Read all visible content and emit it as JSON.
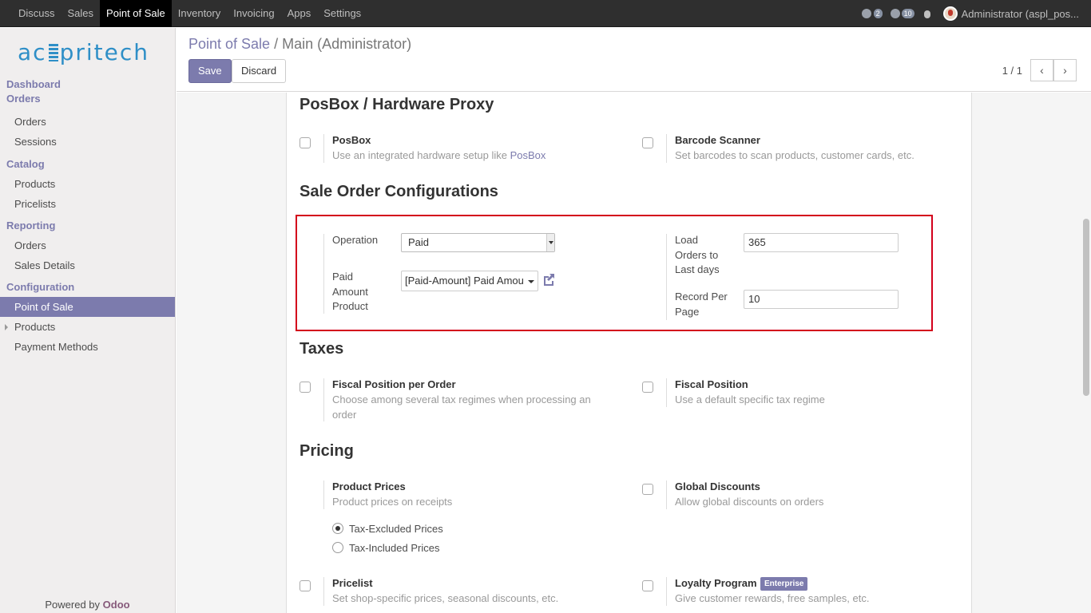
{
  "topbar": {
    "menu": [
      "Discuss",
      "Sales",
      "Point of Sale",
      "Inventory",
      "Invoicing",
      "Apps",
      "Settings"
    ],
    "active_index": 2,
    "activity_count": "2",
    "messages_count": "10",
    "user": "Administrator (aspl_pos..."
  },
  "sidebar": {
    "logo": {
      "before": "ac",
      "after": "pritech"
    },
    "dashboard": "Dashboard",
    "orders_section": "Orders",
    "orders": "Orders",
    "sessions": "Sessions",
    "catalog_section": "Catalog",
    "products": "Products",
    "pricelists": "Pricelists",
    "reporting_section": "Reporting",
    "report_orders": "Orders",
    "sales_details": "Sales Details",
    "configuration_section": "Configuration",
    "point_of_sale": "Point of Sale",
    "config_products": "Products",
    "payment_methods": "Payment Methods",
    "powered_prefix": "Powered by ",
    "powered_brand": "Odoo"
  },
  "cpanel": {
    "crumb_parent": "Point of Sale",
    "crumb_sep": " / ",
    "crumb_current": "Main (Administrator)",
    "save": "Save",
    "discard": "Discard",
    "pager": "1 / 1",
    "prev": "‹",
    "next": "›"
  },
  "form": {
    "posbox_section": "PosBox / Hardware Proxy",
    "posbox_title": "PosBox",
    "posbox_desc": "Use an integrated hardware setup like ",
    "posbox_link": "PosBox",
    "barcode_title": "Barcode Scanner",
    "barcode_desc": "Set barcodes to scan products, customer cards, etc.",
    "sale_order_section": "Sale Order Configurations",
    "operation_label": "Operation",
    "operation_value": "Paid",
    "paid_amount_label_1": "Paid",
    "paid_amount_label_2": "Amount",
    "paid_amount_label_3": "Product",
    "paid_amount_value": "[Paid-Amount] Paid Amou",
    "load_orders_label_1": "Load",
    "load_orders_label_2": "Orders to",
    "load_orders_label_3": "Last days",
    "load_orders_value": "365",
    "record_per_page_label_1": "Record Per",
    "record_per_page_label_2": "Page",
    "record_per_page_value": "10",
    "taxes_section": "Taxes",
    "fiscal_per_order_title": "Fiscal Position per Order",
    "fiscal_per_order_desc_1": "Choose among several tax regimes when processing an",
    "fiscal_per_order_desc_2": "order",
    "fiscal_title": "Fiscal Position",
    "fiscal_desc": "Use a default specific tax regime",
    "pricing_section": "Pricing",
    "product_prices_title": "Product Prices",
    "product_prices_desc": "Product prices on receipts",
    "tax_excluded": "Tax-Excluded Prices",
    "tax_included": "Tax-Included Prices",
    "global_discounts_title": "Global Discounts",
    "global_discounts_desc": "Allow global discounts on orders",
    "pricelist_title": "Pricelist",
    "pricelist_desc": "Set shop-specific prices, seasonal discounts, etc.",
    "loyalty_title": "Loyalty Program",
    "enterprise_badge": "Enterprise",
    "loyalty_desc": "Give customer rewards, free samples, etc."
  },
  "colors": {
    "accent": "#7c7bad",
    "highlight": "#d3001b",
    "navbar": "#2f2f2f"
  }
}
